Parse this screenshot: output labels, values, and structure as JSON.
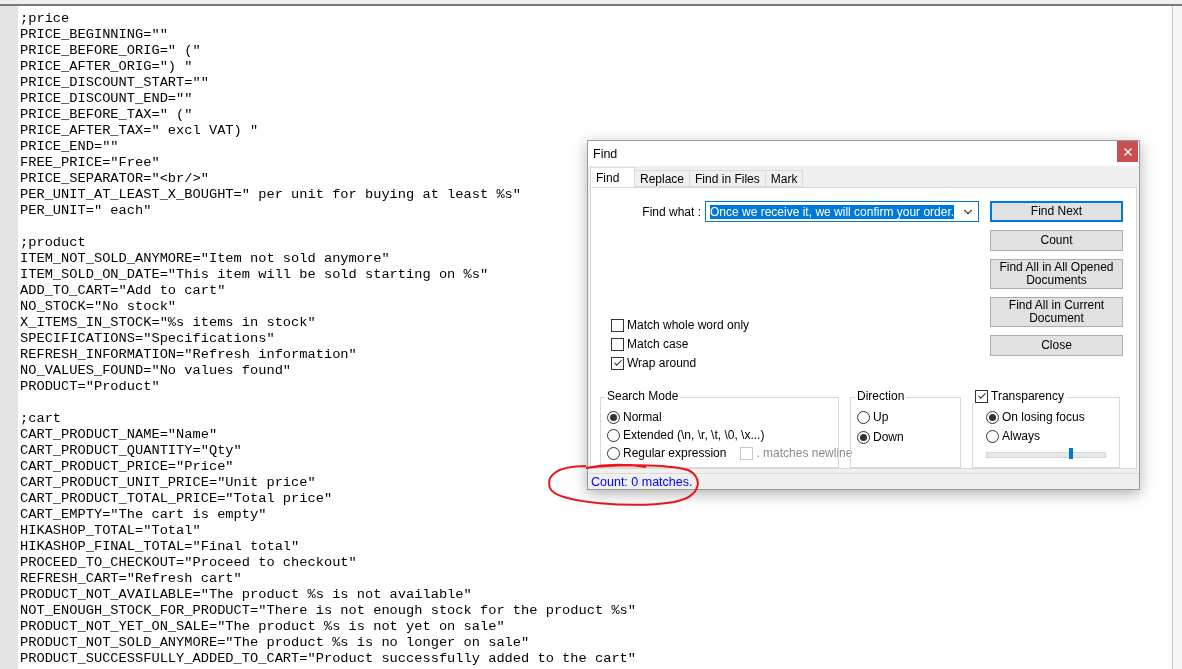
{
  "editor": {
    "sections": [
      {
        "lines": [
          ";price",
          "PRICE_BEGINNING=\"\"",
          "PRICE_BEFORE_ORIG=\" (\"",
          "PRICE_AFTER_ORIG=\") \"",
          "PRICE_DISCOUNT_START=\"\"",
          "PRICE_DISCOUNT_END=\"\"",
          "PRICE_BEFORE_TAX=\" (\"",
          "PRICE_AFTER_TAX=\" excl VAT) \"",
          "PRICE_END=\"\"",
          "FREE_PRICE=\"Free\"",
          "PRICE_SEPARATOR=\"<br/>\"",
          "PER_UNIT_AT_LEAST_X_BOUGHT=\" per unit for buying at least %s\"",
          "PER_UNIT=\" each\""
        ]
      },
      {
        "lines": [
          ";product",
          "ITEM_NOT_SOLD_ANYMORE=\"Item not sold anymore\"",
          "ITEM_SOLD_ON_DATE=\"This item will be sold starting on %s\"",
          "ADD_TO_CART=\"Add to cart\"",
          "NO_STOCK=\"No stock\"",
          "X_ITEMS_IN_STOCK=\"%s items in stock\"",
          "SPECIFICATIONS=\"Specifications\"",
          "REFRESH_INFORMATION=\"Refresh information\"",
          "NO_VALUES_FOUND=\"No values found\"",
          "PRODUCT=\"Product\""
        ]
      },
      {
        "lines": [
          ";cart",
          "CART_PRODUCT_NAME=\"Name\"",
          "CART_PRODUCT_QUANTITY=\"Qty\"",
          "CART_PRODUCT_PRICE=\"Price\"",
          "CART_PRODUCT_UNIT_PRICE=\"Unit price\"",
          "CART_PRODUCT_TOTAL_PRICE=\"Total price\"",
          "CART_EMPTY=\"The cart is empty\"",
          "HIKASHOP_TOTAL=\"Total\"",
          "HIKASHOP_FINAL_TOTAL=\"Final total\"",
          "PROCEED_TO_CHECKOUT=\"Proceed to checkout\"",
          "REFRESH_CART=\"Refresh cart\"",
          "PRODUCT_NOT_AVAILABLE=\"The product %s is not available\"",
          "NOT_ENOUGH_STOCK_FOR_PRODUCT=\"There is not enough stock for the product %s\"",
          "PRODUCT_NOT_YET_ON_SALE=\"The product %s is not yet on sale\"",
          "PRODUCT_NOT_SOLD_ANYMORE=\"The product %s is no longer on sale\"",
          "PRODUCT_SUCCESSFULLY_ADDED_TO_CART=\"Product successfully added to the cart\""
        ]
      }
    ]
  },
  "find_dialog": {
    "title": "Find",
    "tabs": [
      {
        "label": "Find",
        "selected": true
      },
      {
        "label": "Replace",
        "selected": false
      },
      {
        "label": "Find in Files",
        "selected": false
      },
      {
        "label": "Mark",
        "selected": false
      }
    ],
    "find_what": {
      "label": "Find what :",
      "value": "Once we receive it, we will confirm your order."
    },
    "buttons": [
      {
        "label": "Find Next",
        "focused": true
      },
      {
        "label": "Count",
        "focused": false
      },
      {
        "label": "Find All in All Opened Documents",
        "focused": false
      },
      {
        "label": "Find All in Current Document",
        "focused": false
      },
      {
        "label": "Close",
        "focused": false
      }
    ],
    "options": [
      {
        "label": "Match whole word only",
        "checked": false
      },
      {
        "label": "Match case",
        "checked": false
      },
      {
        "label": "Wrap around",
        "checked": true
      }
    ],
    "search_mode": {
      "title": "Search Mode",
      "options": [
        {
          "label": "Normal",
          "selected": true
        },
        {
          "label": "Extended (\\n, \\r, \\t, \\0, \\x...)",
          "selected": false
        },
        {
          "label": "Regular expression",
          "selected": false
        }
      ],
      "newline_option": {
        "label": ". matches newline",
        "checked": false,
        "disabled": true
      }
    },
    "direction": {
      "title": "Direction",
      "options": [
        {
          "label": "Up",
          "selected": false
        },
        {
          "label": "Down",
          "selected": true
        }
      ]
    },
    "transparency": {
      "label": "Transparency",
      "checked": true,
      "options": [
        {
          "label": "On losing focus",
          "selected": true
        },
        {
          "label": "Always",
          "selected": false
        }
      ],
      "level": 0.71
    },
    "status": "Count: 0 matches."
  }
}
